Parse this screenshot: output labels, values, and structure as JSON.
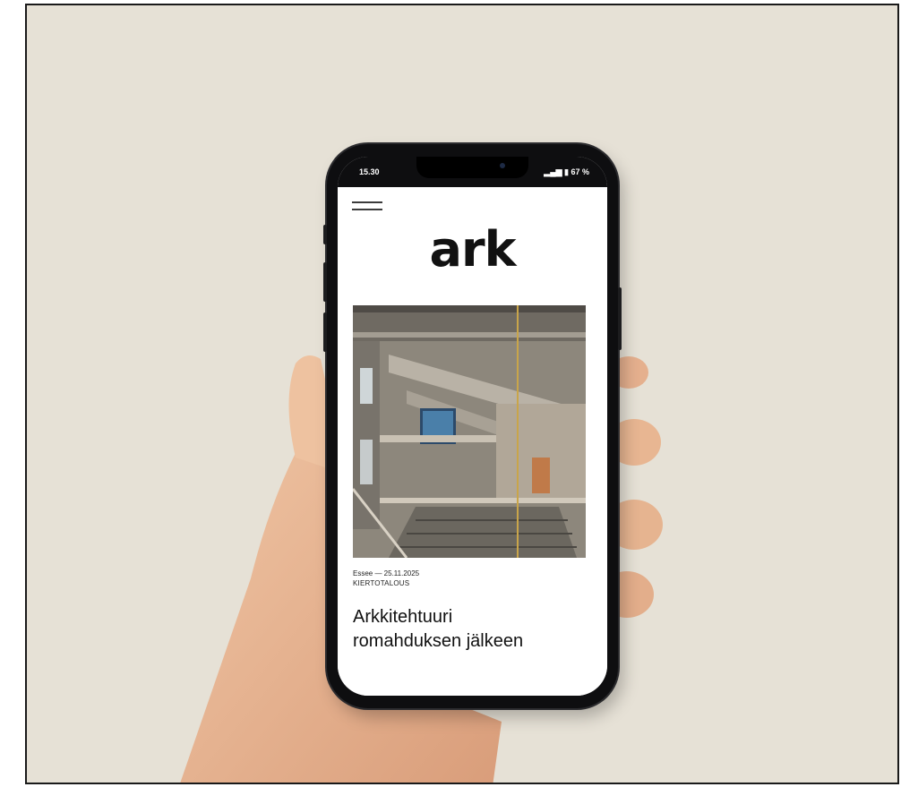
{
  "status_bar": {
    "time": "15.30",
    "right": "5G▏▍ 67 %",
    "battery": "67 %"
  },
  "site": {
    "logo": "ark"
  },
  "article": {
    "meta_line": "Essee — 25.11.2025",
    "category": "KIERTOTALOUS",
    "headline_line1": "Arkkitehtuuri",
    "headline_line2": "romahduksen jälkeen"
  },
  "icons": {
    "menu": "hamburger-menu-icon"
  },
  "colors": {
    "background": "#e6e1d6",
    "phone": "#0e0e10",
    "screen": "#ffffff",
    "text": "#111111"
  }
}
